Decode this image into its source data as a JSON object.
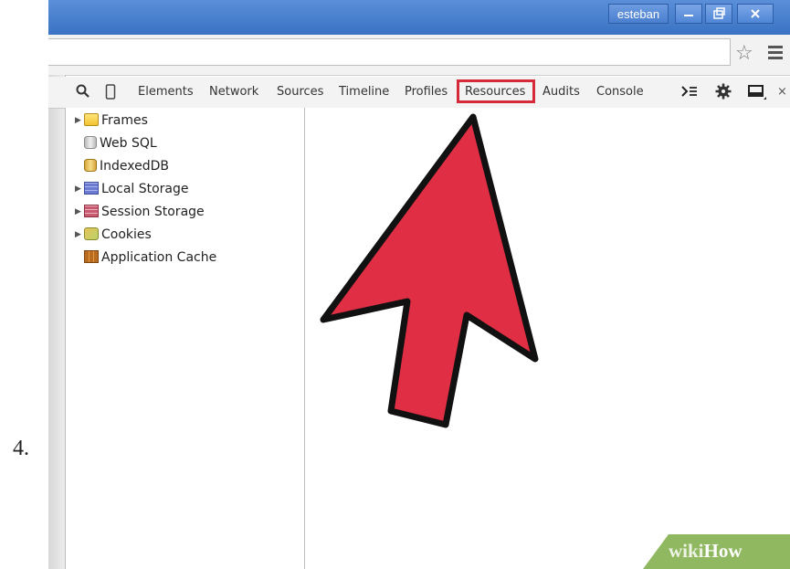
{
  "step_label": "4.",
  "titlebar": {
    "user": "esteban"
  },
  "devtools": {
    "tabs": [
      "Elements",
      "Network",
      "Sources",
      "Timeline",
      "Profiles",
      "Resources",
      "Audits",
      "Console"
    ],
    "highlighted_tab": "Resources",
    "close_glyph": "×"
  },
  "sidebar": {
    "items": [
      {
        "label": "Frames",
        "icon": "folder-icon",
        "expandable": true
      },
      {
        "label": "Web SQL",
        "icon": "database-icon",
        "expandable": false
      },
      {
        "label": "IndexedDB",
        "icon": "database-yellow-icon",
        "expandable": false
      },
      {
        "label": "Local Storage",
        "icon": "storage-grid-icon",
        "expandable": true
      },
      {
        "label": "Session Storage",
        "icon": "storage-grid-red-icon",
        "expandable": true
      },
      {
        "label": "Cookies",
        "icon": "cookie-icon",
        "expandable": true
      },
      {
        "label": "Application Cache",
        "icon": "appcache-icon",
        "expandable": false
      }
    ]
  },
  "watermark": {
    "part1": "wiki",
    "part2": "How"
  },
  "colors": {
    "highlight": "#d62a3b",
    "arrow": "#e02f44",
    "watermark": "#8fb860",
    "titlebar": "#3a73c4"
  }
}
